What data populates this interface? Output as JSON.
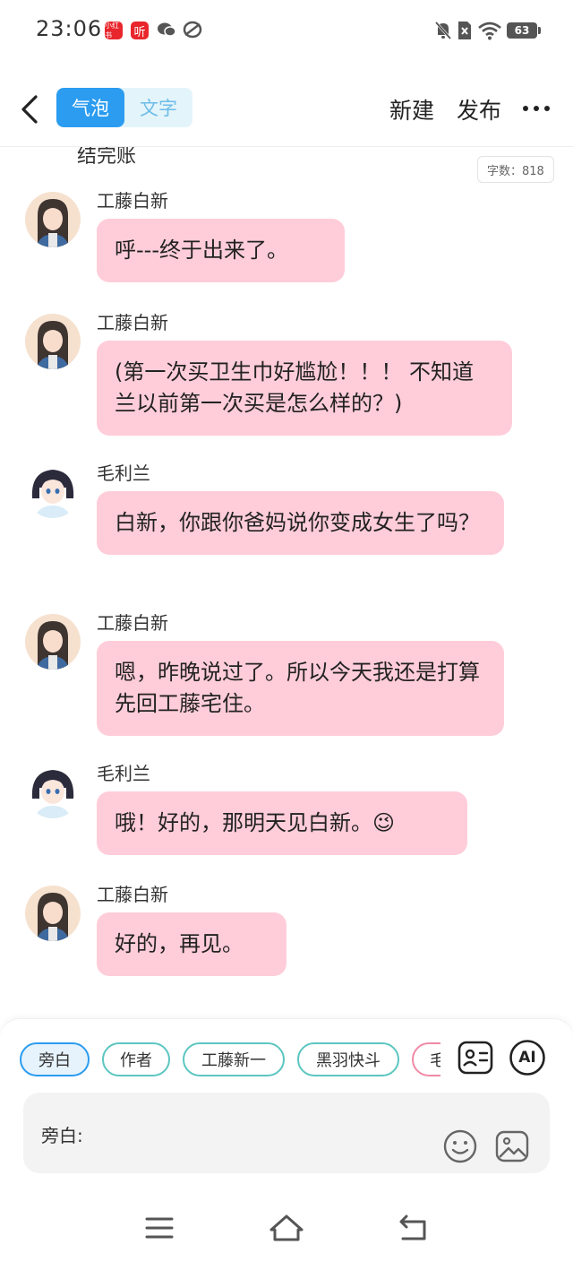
{
  "status_bar": {
    "time": "23:06",
    "app_badges": [
      "小红书",
      "听"
    ],
    "battery": "63"
  },
  "header": {
    "tabs": [
      {
        "label": "气泡",
        "active": true
      },
      {
        "label": "文字",
        "active": false
      }
    ],
    "new_label": "新建",
    "publish_label": "发布"
  },
  "chat": {
    "cut_off_text": "结完账",
    "word_count": "字数：818",
    "messages": [
      {
        "sender": "工藤白新",
        "text": "呼---终于出来了。"
      },
      {
        "sender": "工藤白新",
        "text": "(第一次买卫生巾好尴尬！！！ 不知道兰以前第一次买是怎么样的？)"
      },
      {
        "sender": "毛利兰",
        "text": "白新，你跟你爸妈说你变成女生了吗？"
      },
      {
        "sender": "工藤白新",
        "text": "嗯，昨晚说过了。所以今天我还是打算先回工藤宅住。"
      },
      {
        "sender": "毛利兰",
        "text": "哦！好的，那明天见白新。😉"
      },
      {
        "sender": "工藤白新",
        "text": "好的，再见。"
      }
    ]
  },
  "composer": {
    "roles": [
      "旁白",
      "作者",
      "工藤新一",
      "黑羽快斗",
      "毛"
    ],
    "ai_label": "AI",
    "input_label": "旁白:"
  },
  "colors": {
    "accent": "#2b9cf0",
    "bubble": "#ffcdd9",
    "chip_border": "#5cc6c0"
  },
  "icons": [
    "back-arrow-icon",
    "more-icon",
    "role-card-icon",
    "emoji-icon",
    "image-icon",
    "menu-icon",
    "home-icon",
    "return-icon"
  ]
}
